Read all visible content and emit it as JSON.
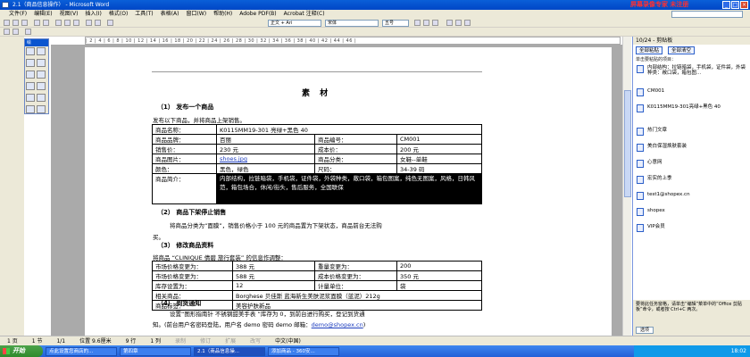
{
  "window": {
    "title": "2.1（商品信息操作） - Microsoft Word",
    "recorder_label": "屏幕录像专家 未注册"
  },
  "menubar": [
    "文件(F)",
    "编辑(E)",
    "视图(V)",
    "插入(I)",
    "格式(O)",
    "工具(T)",
    "表格(A)",
    "窗口(W)",
    "帮助(H)",
    "Adobe PDF(B)",
    "Acrobat 注释(C)"
  ],
  "toolbar": {
    "style": "正文 + Ari",
    "font": "宋体",
    "size": "五号"
  },
  "ruler": "| 2 | 4 | 6 | 8 | 10 | 12 | 14 | 16 | 18 | 20 | 22 | 24 | 26 | 28 | 30 | 32 | 34 | 36 | 38 | 40 | 42 | 44 | 46 |",
  "draw_panel_title": "绘",
  "doc": {
    "title": "素 材",
    "s1": "（1） 发布一个商品",
    "p1": "发布以下商品，并将商品上架销售。",
    "table1": [
      [
        "商品名称：",
        "K0115MM19-301 亮绿+黑色 40",
        "",
        ""
      ],
      [
        "商品品牌：",
        "百丽",
        "商品编号：",
        "CM001"
      ],
      [
        "销售价：",
        "230 元",
        "成本价：",
        "200 元"
      ],
      [
        "商品图片：",
        "shoes.jpg",
        "商品分类：",
        "女鞋--单鞋"
      ],
      [
        "颜色：",
        "黑色，绿色",
        "尺码：",
        "34-39 码"
      ]
    ],
    "t1_desc_label": "商品简介：",
    "t1_desc": "内部结构，拉链暗袋，手机袋，证件袋，外袋种类，敞口袋，箱包图案，纯色无图案，风格，日韩风范，箱包场合，休闲/街头，售后服务，全国联保",
    "s2": "（2） 商品下架停止销售",
    "p2a": "将商品分类为“面膜”，销售价格小于 100 元的商品置为下架状态，商品前台无法购",
    "p2b": "买。",
    "s3": "（3） 修改商品资料",
    "p3": "将商品 “CLINIQUE 倩碧 旅行套装” 的信息作调整：",
    "table2": [
      [
        "市场价格变更为：",
        "388 元",
        "重量变更为：",
        "200"
      ],
      [
        "市场价格变更为：",
        "588 元",
        "成本价格变更为：",
        "350 元"
      ],
      [
        "库存设置为：",
        "12",
        "计量单位：",
        "袋"
      ]
    ],
    "t2_related_label": "相关商品：",
    "t2_related": "Borghese 贝佳斯 蓝海新生美肤泥浆面膜（蓝泥）212g",
    "t2_tag_label": "商品标签：",
    "t2_tag": "美容护肤新品",
    "s4": "（4） 到货通知",
    "p4a": "设置“图形指南针 不锈钢甜美手表 ”库存为 0，到前台进行购买，登记到货通",
    "p4b_pre": "知。(前台用户名密码登陆，用户名 demo 密码 demo  邮箱：",
    "p4b_email": "demo@shopex.cn",
    "p4b_post": ")"
  },
  "taskpane": {
    "header": "10/24 - 剪贴板",
    "paste_all": "全部粘贴",
    "clear_all": "全部清空",
    "label": "单击要粘贴的项目：",
    "items": [
      "内部结构：拉链暗袋，手机袋，证件袋，外袋种类：敞口袋，箱包图...",
      "CM001",
      "K0115MM19-301亮绿+黑色 40",
      "热门文章",
      "美白保湿焕肤套装",
      "心意网",
      "宏实的上季",
      "test1@shopex.cn",
      "shopex",
      "VIP会员"
    ],
    "footer": "要将此任务窗格，请单击“编辑”菜单中的“Office 剪贴板”命令，或者按 Ctrl+C 两次。",
    "options": "选项"
  },
  "status": [
    "1 页",
    "1 节",
    "1/1",
    "位置 9.6厘米",
    "9 行",
    "1 列",
    "录制",
    "修订",
    "扩展",
    "改写",
    "中文(中国)"
  ],
  "taskbar": {
    "start": "开始",
    "tasks": [
      "点此设置您商店的...",
      "第四章",
      "2.1（商品信息操...",
      "添加商品 - 360安..."
    ],
    "clock": "18:02"
  }
}
